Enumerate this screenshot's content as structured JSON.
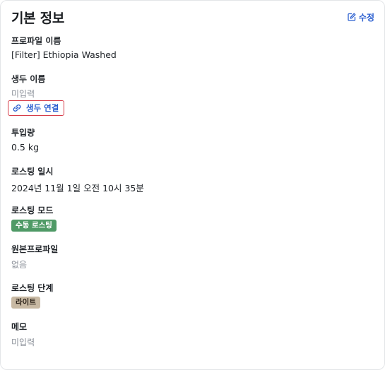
{
  "header": {
    "title": "기본 정보",
    "edit_label": "수정",
    "edit_icon": "edit-icon"
  },
  "fields": {
    "profile_name": {
      "label": "프로파일 이름",
      "value": "[Filter] Ethiopia Washed"
    },
    "green_bean_name": {
      "label": "생두 이름",
      "value": "미입력",
      "link_label": "생두 연결",
      "link_icon": "link-icon"
    },
    "input_amount": {
      "label": "투입량",
      "value": "0.5 kg"
    },
    "roasting_datetime": {
      "label": "로스팅 일시",
      "value": "2024년 11월 1일 오전 10시 35분"
    },
    "roasting_mode": {
      "label": "로스팅 모드",
      "value": "수동 로스팅"
    },
    "original_profile": {
      "label": "원본프로파일",
      "value": "없음"
    },
    "roasting_level": {
      "label": "로스팅 단계",
      "value": "라이트"
    },
    "memo": {
      "label": "메모",
      "value": "미입력"
    }
  },
  "colors": {
    "accent": "#2b5fd0",
    "highlight_border": "#d63b48",
    "manual_badge": "#4f9a66",
    "light_badge": "#c8b9a3",
    "muted_text": "#8b9099"
  }
}
